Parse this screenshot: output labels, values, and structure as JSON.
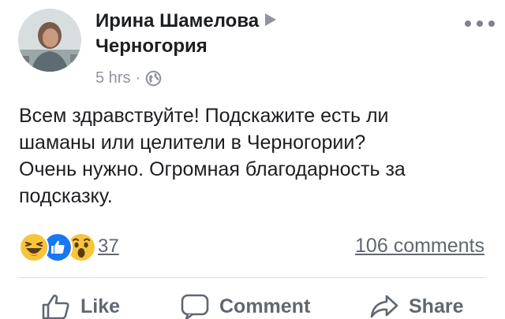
{
  "post": {
    "author": "Ирина Шамелова",
    "group": "Черногория",
    "time": "5 hrs",
    "separator": "·",
    "privacy_icon": "globe-icon",
    "body_lines": [
      "Всем здравствуйте! Подскажите есть ли",
      "шаманы или целители в Черногории?",
      "Очень нужно. Огромная благодарность за",
      "подсказку."
    ],
    "reactions": {
      "icons": [
        "haha-icon",
        "like-icon",
        "wow-icon"
      ],
      "count": "37"
    },
    "comments_label": "106 comments"
  },
  "actions": {
    "like": "Like",
    "comment": "Comment",
    "share": "Share"
  },
  "colors": {
    "text": "#1c1e21",
    "meta": "#90949c",
    "secondary": "#606770",
    "like_blue": "#1877f2",
    "emoji_yellow": "#f7c53b"
  }
}
